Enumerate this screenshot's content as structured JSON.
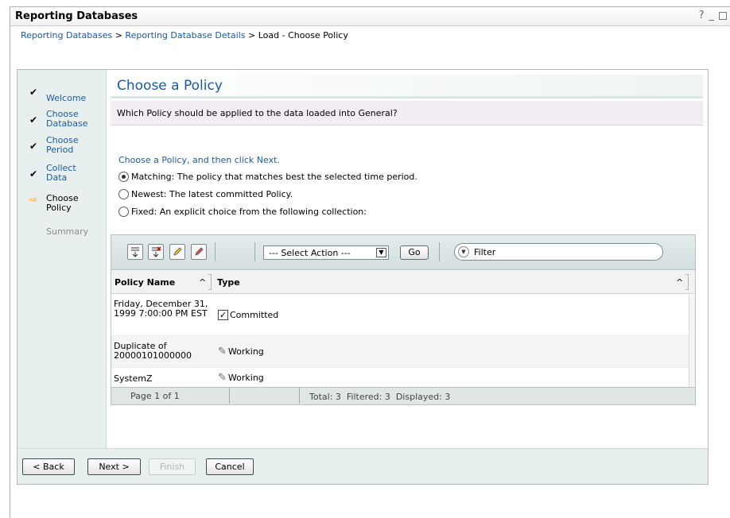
{
  "portlet": {
    "title": "Reporting Databases",
    "help_label": "?",
    "minimize_label": "_"
  },
  "breadcrumb": {
    "items": [
      "Reporting Databases",
      "Reporting Database Details"
    ],
    "separator": " > ",
    "current": "Load - Choose Policy"
  },
  "steps": [
    {
      "label": "Welcome",
      "state": "done"
    },
    {
      "label": "Choose Database",
      "state": "done"
    },
    {
      "label": "Choose Period",
      "state": "done"
    },
    {
      "label": "Collect Data",
      "state": "done"
    },
    {
      "label": "Choose Policy",
      "state": "current"
    },
    {
      "label": "Summary",
      "state": "future"
    }
  ],
  "heading": "Choose a Policy",
  "question": "Which Policy should be applied to the data loaded into General?",
  "instruction": "Choose a Policy, and then click Next.",
  "options": [
    {
      "label": "Matching: The policy that matches best the selected time period.",
      "selected": true
    },
    {
      "label": "Newest: The latest committed Policy.",
      "selected": false
    },
    {
      "label": "Fixed: An explicit choice from the following collection:",
      "selected": false
    }
  ],
  "table": {
    "select_action": "--- Select Action ---",
    "go_label": "Go",
    "filter_placeholder": "Filter",
    "columns": [
      "Policy Name",
      "Type"
    ],
    "sort_indicator": "^",
    "rows": [
      {
        "name": "Friday, December 31, 1999 7:00:00 PM EST",
        "type": "Committed",
        "icon": "check-icon"
      },
      {
        "name": "Duplicate of 20000101000000",
        "type": "Working",
        "icon": "pencil-icon"
      },
      {
        "name": "SystemZ",
        "type": "Working",
        "icon": "pencil-icon"
      }
    ],
    "footer": {
      "page": "Page 1 of 1",
      "totals": "Total: 3  Filtered: 3  Displayed: 3"
    }
  },
  "buttons": {
    "back": "< Back",
    "next": "Next >",
    "finish": "Finish",
    "cancel": "Cancel"
  }
}
